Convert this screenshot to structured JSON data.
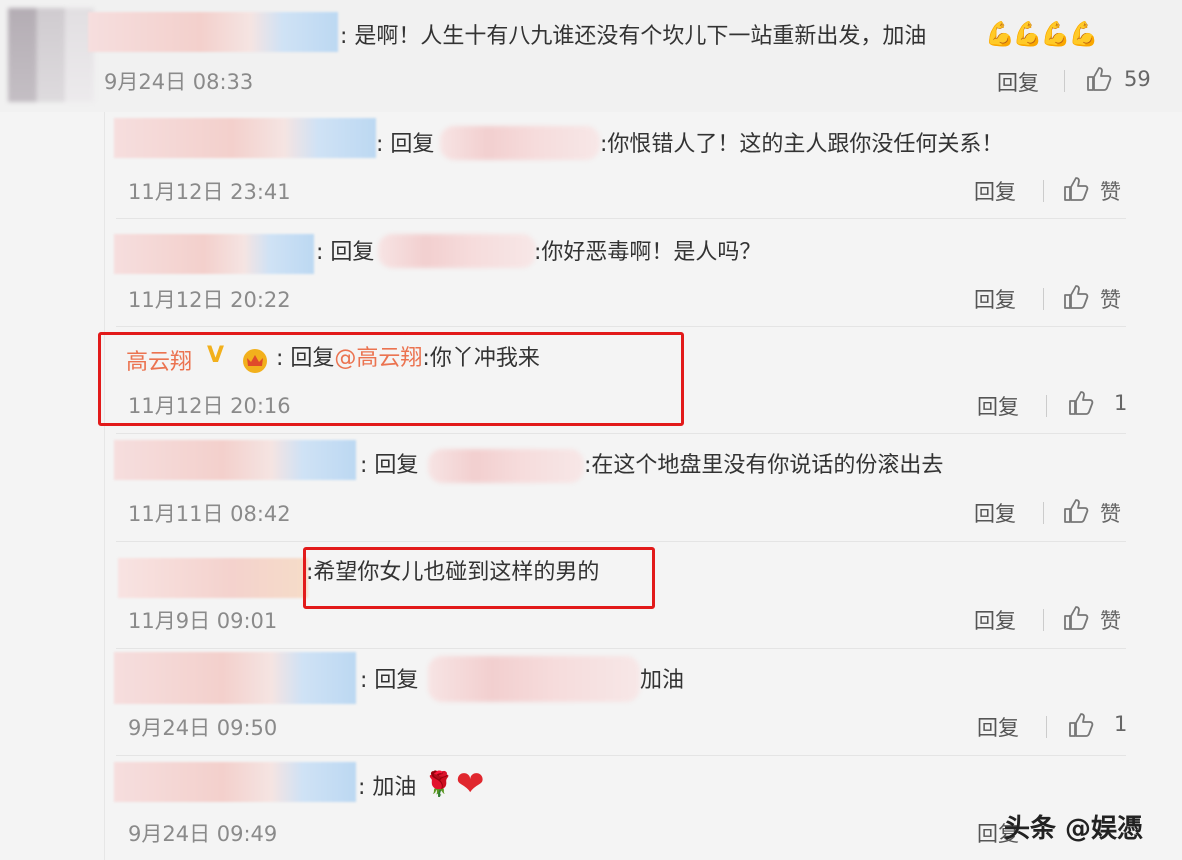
{
  "top_comment": {
    "text": ": 是啊！人生十有八九谁还没有个坎儿下一站重新出发，加油",
    "emoji": "💪💪💪💪",
    "time": "9月24日 08:33",
    "reply": "回复",
    "likes": "59"
  },
  "replies": [
    {
      "prefix": ": 回复",
      "text": ":你恨错人了！这的主人跟你没任何关系！",
      "time": "11月12日 23:41",
      "reply": "回复",
      "likes": "赞"
    },
    {
      "prefix": ": 回复",
      "text": ":你好恶毒啊！是人吗？",
      "time": "11月12日 20:22",
      "reply": "回复",
      "likes": "赞"
    },
    {
      "name": "高云翔",
      "badge": "V",
      "prefix": ": 回复",
      "at": "@高云翔",
      "text": ":你丫冲我来",
      "time": "11月12日 20:16",
      "reply": "回复",
      "likes": "1"
    },
    {
      "prefix": ": 回复",
      "text": ":在这个地盘里没有你说话的份滚出去",
      "time": "11月11日 08:42",
      "reply": "回复",
      "likes": "赞"
    },
    {
      "text": ":希望你女儿也碰到这样的男的",
      "time": "11月9日 09:01",
      "reply": "回复",
      "likes": "赞"
    },
    {
      "prefix": ": 回复",
      "text": "加油",
      "time": "9月24日 09:50",
      "reply": "回复",
      "likes": "1"
    },
    {
      "text": ": 加油",
      "emoji_rose": "🌹",
      "emoji_heart": "❤",
      "time": "9月24日 09:49",
      "reply": "回复"
    }
  ],
  "watermark": "头条 @娱憑",
  "colors": {
    "highlight_box": "#e21a1a",
    "name_orange": "#eb7350",
    "badge_gold": "#f2b01c"
  }
}
